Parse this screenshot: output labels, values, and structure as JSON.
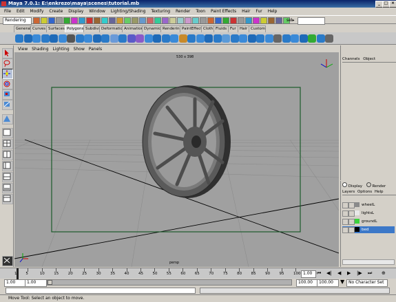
{
  "window": {
    "title": "Maya 7.0.1: E:\\enkrezo\\maya\\scenes\\tutorial.mb",
    "min": "_",
    "max": "□",
    "close": "×"
  },
  "menubar": [
    "File",
    "Edit",
    "Modify",
    "Create",
    "Display",
    "Window",
    "Lighting/Shading",
    "Texturing",
    "Render",
    "Toon",
    "Paint Effects",
    "Hair",
    "Fur",
    "Help"
  ],
  "statusline": {
    "mode": "Rendering",
    "sel_label": "sel▸",
    "sel_value": ""
  },
  "shelf_tabs": [
    "General",
    "Curves",
    "Surfaces",
    "Polygons",
    "Subdivs",
    "Deformation",
    "Animation",
    "Dynamics",
    "Rendering",
    "PaintEffects",
    "Cloth",
    "Fluids",
    "Fur",
    "Hair",
    "Custom"
  ],
  "active_shelf_tab": "Polygons",
  "panel_menu": [
    "View",
    "Shading",
    "Lighting",
    "Show",
    "Panels"
  ],
  "viewport": {
    "resolution": "530 x 398",
    "camera": "persp"
  },
  "channel_box": {
    "tabs": [
      "Channels",
      "Object"
    ]
  },
  "layer_editor": {
    "mode_display": "Display",
    "mode_render": "Render",
    "menu": [
      "Layers",
      "Options",
      "Help"
    ],
    "layers": [
      {
        "name": "wheelL",
        "color": "#8a8a8a",
        "selected": false
      },
      {
        "name": "lightsL",
        "color": "#e8e8e8",
        "selected": false
      },
      {
        "name": "groundL",
        "color": "#3cd23c",
        "selected": false
      },
      {
        "name": "bed",
        "color": "#000000",
        "selected": true
      }
    ]
  },
  "time_slider": {
    "ticks": [
      "1",
      "5",
      "10",
      "15",
      "20",
      "25",
      "30",
      "35",
      "40",
      "45",
      "50",
      "55",
      "60",
      "65",
      "70",
      "75",
      "80",
      "85",
      "90",
      "95",
      "100"
    ],
    "current_frame": "1.00"
  },
  "range_slider": {
    "start": "1.00",
    "inner_start": "1.00",
    "inner_end": "100.00",
    "end": "100.00",
    "character_set": "No Character Set"
  },
  "help_line": "Move Tool: Select an object to move."
}
